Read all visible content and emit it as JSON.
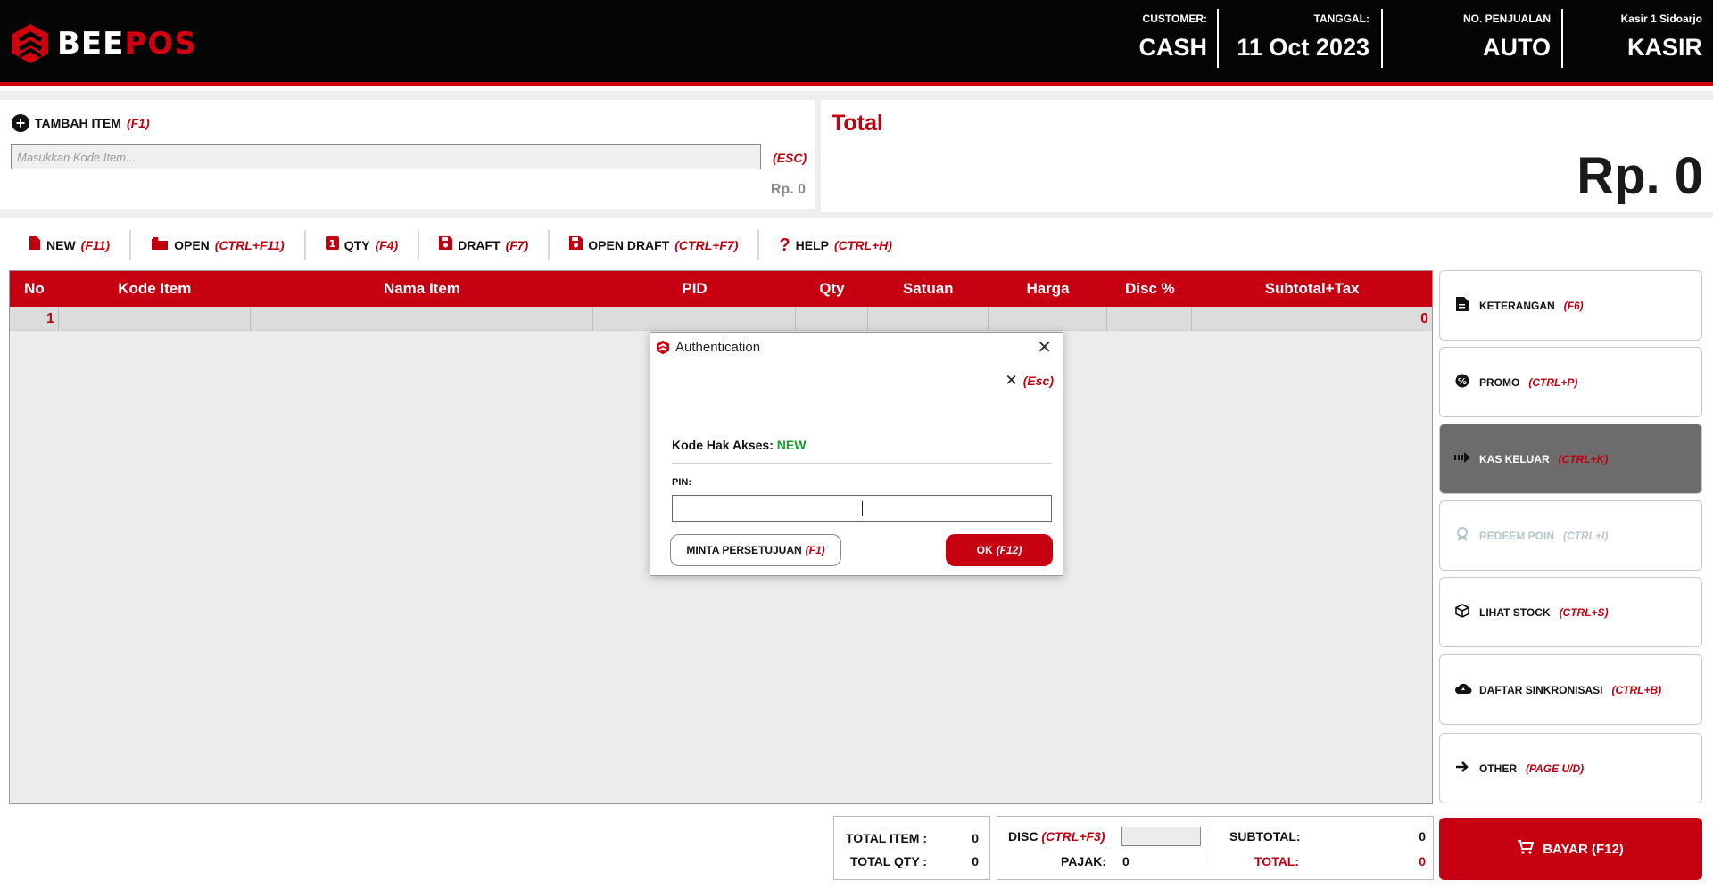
{
  "brand": {
    "part1": "BEE",
    "part2": "POS",
    "color": "#d0000f"
  },
  "header": {
    "customer_label": "CUSTOMER:",
    "customer_value": "CASH",
    "date_label": "TANGGAL:",
    "date_value": "11 Oct 2023",
    "sale_label": "NO. PENJUALAN",
    "sale_value": "AUTO",
    "cashier_label": "Kasir 1 Sidoarjo",
    "cashier_value": "KASIR"
  },
  "add_item": {
    "title": "TAMBAH ITEM",
    "hotkey": "(F1)",
    "placeholder": "Masukkan Kode Item...",
    "esc": "(ESC)",
    "price": "Rp. 0"
  },
  "total": {
    "title": "Total",
    "value": "Rp. 0"
  },
  "toolbar": [
    {
      "label": "NEW",
      "hotkey": "(F11)"
    },
    {
      "label": "OPEN",
      "hotkey": "(CTRL+F11)"
    },
    {
      "label": "QTY",
      "hotkey": "(F4)"
    },
    {
      "label": "DRAFT",
      "hotkey": "(F7)"
    },
    {
      "label": "OPEN DRAFT",
      "hotkey": "(CTRL+F7)"
    },
    {
      "label": "HELP",
      "hotkey": "(CTRL+H)"
    }
  ],
  "table": {
    "columns": [
      "No",
      "Kode Item",
      "Nama Item",
      "PID",
      "Qty",
      "Satuan",
      "Harga",
      "Disc %",
      "Subtotal+Tax"
    ],
    "rows": [
      {
        "no": "1",
        "subtotal": "0"
      }
    ]
  },
  "side_buttons": [
    {
      "label": "KETERANGAN",
      "hotkey": "(F6)",
      "icon": "note-icon"
    },
    {
      "label": "PROMO",
      "hotkey": "(CTRL+P)",
      "icon": "badge-icon"
    },
    {
      "label": "KAS KELUAR",
      "hotkey": "(CTRL+K)",
      "icon": "cash-out-icon"
    },
    {
      "label": "REDEEM POIN",
      "hotkey": "(CTRL+I)",
      "icon": "award-icon"
    },
    {
      "label": "LIHAT STOCK",
      "hotkey": "(CTRL+S)",
      "icon": "box-icon"
    },
    {
      "label": "DAFTAR SINKRONISASI",
      "hotkey": "(CTRL+B)",
      "icon": "cloud-sync-icon"
    },
    {
      "label": "OTHER",
      "hotkey": "(PAGE U/D)",
      "icon": "arrow-right-icon"
    }
  ],
  "summary": {
    "total_item_label": "TOTAL ITEM :",
    "total_item": "0",
    "total_qty_label": "TOTAL QTY :",
    "total_qty": "0",
    "disc_label": "DISC",
    "disc_hotkey": "(CTRL+F3)",
    "pajak_label": "PAJAK:",
    "pajak": "0",
    "subtotal_label": "SUBTOTAL:",
    "subtotal": "0",
    "total_label": "TOTAL:",
    "total": "0"
  },
  "bayar": {
    "label": "BAYAR (F12)"
  },
  "modal": {
    "title": "Authentication",
    "esc": "(Esc)",
    "kode_label": "Kode Hak Akses:",
    "kode_value": "NEW",
    "pin_label": "PIN:",
    "btn_minta": "MINTA PERSETUJUAN",
    "btn_minta_hotkey": "(F1)",
    "btn_ok": "OK",
    "btn_ok_hotkey": "(F12)"
  }
}
